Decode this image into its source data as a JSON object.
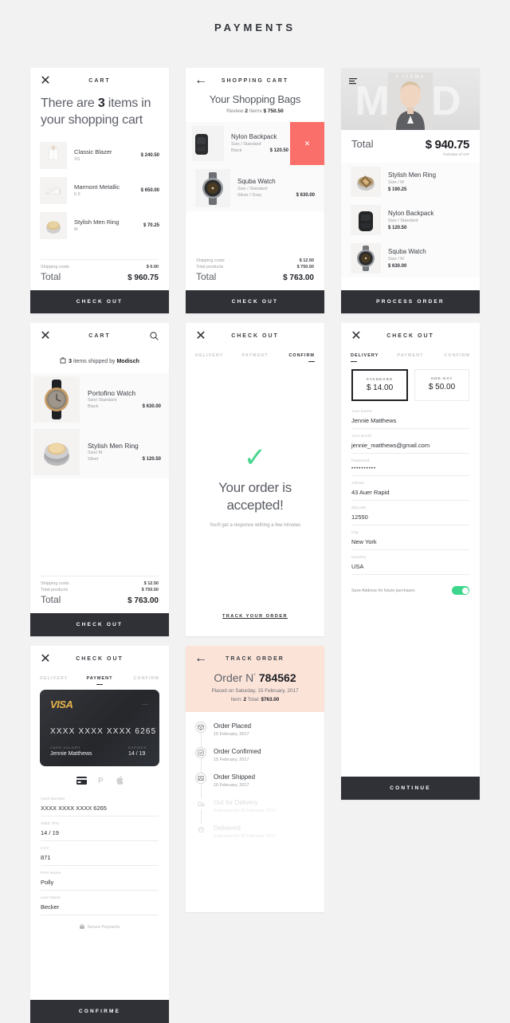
{
  "page": {
    "title": "PAYMENTS"
  },
  "card1": {
    "topbar": {
      "close": "✕",
      "title": "CART"
    },
    "headline_pre": "There are ",
    "headline_num": "3",
    "headline_post": " items in your shopping cart",
    "items": [
      {
        "name": "Classic Blazer",
        "size": "XS",
        "price": "$ 240.50"
      },
      {
        "name": "Marmont Metallic",
        "size": "6.5",
        "price": "$ 650.00"
      },
      {
        "name": "Stylish Men Ring",
        "size": "M",
        "price": "$ 70.25"
      }
    ],
    "shipping_label": "Shipping costs",
    "shipping_value": "$ 0.00",
    "total_label": "Total",
    "total_value": "$ 960.75",
    "cta": "CHECK OUT"
  },
  "card2": {
    "topbar": {
      "back": "←",
      "title": "SHOPPING CART"
    },
    "title": "Your Shopping Bags",
    "review_pre": "Review ",
    "review_count": "2",
    "review_post": " Items ",
    "review_total": "$ 750.50",
    "items": [
      {
        "name": "Nylon Backpack",
        "size": "Size / Standard",
        "color": "Black",
        "price": "$ 120.50",
        "delete": "✕"
      },
      {
        "name": "Squba Watch",
        "size": "Size / Standard",
        "color": "Silver / Grey",
        "price": "$ 630.00"
      }
    ],
    "shipping_label": "Shipping costs",
    "shipping_value": "$ 12.50",
    "products_label": "Total products",
    "products_value": "$ 750.50",
    "total_label": "Total",
    "total_value": "$ 763.00",
    "cta": "CHECK OUT"
  },
  "card3": {
    "hero_items": "3 ITEMS",
    "total_label": "Total",
    "total_value": "$ 940.75",
    "vat_note": "*inclusive of VAT",
    "items": [
      {
        "name": "Stylish Men Ring",
        "size": "Size / M",
        "price": "$ 190.25"
      },
      {
        "name": "Nylon Backpack",
        "size": "Size / Standard",
        "price": "$ 120.50"
      },
      {
        "name": "Squba Watch",
        "size": "Size / M",
        "price": "$ 630.00"
      }
    ],
    "cta": "PROCESS ORDER"
  },
  "card4": {
    "topbar": {
      "close": "✕",
      "title": "CART"
    },
    "shipped_pre": "3",
    "shipped_mid": " items shipped by ",
    "shipped_brand": "Modisch",
    "items": [
      {
        "name": "Portofino Watch",
        "size": "Size/ Standard",
        "color": "Black",
        "price": "$ 630.00"
      },
      {
        "name": "Stylish Men Ring",
        "size": "Size/ M",
        "color": "Silver",
        "price": "$ 120.50"
      }
    ],
    "shipping_label": "Shipping costs",
    "shipping_value": "$ 12.50",
    "products_label": "Total products",
    "products_value": "$ 750.50",
    "total_label": "Total",
    "total_value": "$ 763.00",
    "cta": "CHECK OUT"
  },
  "card5": {
    "topbar": {
      "close": "✕",
      "title": "CHECK OUT"
    },
    "steps": {
      "delivery": "DELIVERY",
      "payment": "PAYMENT",
      "confirm": "CONFIRM"
    },
    "check": "✓",
    "title": "Your order is accepted!",
    "subtitle": "You'll get a responce withing a few minutes",
    "track_link": "TRACK YOUR ORDER"
  },
  "card6": {
    "topbar": {
      "close": "✕",
      "title": "CHECK OUT"
    },
    "steps": {
      "delivery": "DELIVERY",
      "payment": "PAYMENT",
      "confirm": "CONFIRM"
    },
    "options": [
      {
        "name": "STANDARD",
        "price": "$ 14.00",
        "selected": true
      },
      {
        "name": "ONE-DAY",
        "price": "$ 50.00",
        "selected": false
      }
    ],
    "fields": [
      {
        "label": "Your Name",
        "value": "Jennie Matthews"
      },
      {
        "label": "Your Email",
        "value": "jennie_matthews@gmail.com"
      },
      {
        "label": "Password",
        "value": "••••••••••"
      },
      {
        "label": "Adress",
        "value": "43 Auer Rapid"
      },
      {
        "label": "Zipcode",
        "value": "12550"
      },
      {
        "label": "City",
        "value": "New York"
      },
      {
        "label": "Country",
        "value": "USA"
      }
    ],
    "save_label": "Save Address for future purchases",
    "toggle_on": true,
    "cta": "CONTINUE"
  },
  "card7": {
    "topbar": {
      "close": "✕",
      "title": "CHECK OUT"
    },
    "steps": {
      "delivery": "DELIVERY",
      "payment": "PAYMENT",
      "confirm": "CONFIRM"
    },
    "card": {
      "brand": "VISA",
      "menu": "⋯",
      "number": "XXXX  XXXX  XXXX  6265",
      "holder_label": "CARD HOLDER",
      "holder_value": "Jennie Matthews",
      "expires_label": "EXPIRES",
      "expires_value": "14 / 19"
    },
    "methods": [
      {
        "icon": "credit-card-icon",
        "active": true
      },
      {
        "icon": "paypal-icon",
        "active": false
      },
      {
        "icon": "apple-pay-icon",
        "active": false
      }
    ],
    "fields": [
      {
        "label": "Card Number",
        "value": "XXXX XXXX XXXX 6265"
      },
      {
        "label": "Valid Thru",
        "value": "14 / 19"
      },
      {
        "label": "CVV",
        "value": "871"
      },
      {
        "label": "First Name",
        "value": "Polly"
      },
      {
        "label": "Last Name",
        "value": "Becker"
      }
    ],
    "secure_text": "Secure Payments",
    "cta": "CONFIRME"
  },
  "card8": {
    "topbar": {
      "back": "←",
      "title": "TRACK ORDER"
    },
    "order_label": "Order N",
    "order_sup": "°",
    "order_number": "784562",
    "placed": "Placed on Saturday, 15 February, 2017",
    "item_label": "Item: ",
    "item_count": "2",
    "total_label": "  Total: ",
    "total_value": "$763.00",
    "timeline": [
      {
        "name": "Order Placed",
        "date": "15 February, 2017",
        "icon": "box-icon",
        "done": true
      },
      {
        "name": "Order Confirmed",
        "date": "15 February, 2017",
        "icon": "check-box-icon",
        "done": true
      },
      {
        "name": "Order Shipped",
        "date": "16 February, 2017",
        "icon": "ship-icon",
        "done": true
      },
      {
        "name": "Out for Delivery",
        "date": "Estimated for 18 February, 2017",
        "icon": "truck-icon",
        "done": false
      },
      {
        "name": "Delivered",
        "date": "Estimated for 18 February, 2017",
        "icon": "home-icon",
        "done": false
      }
    ]
  }
}
